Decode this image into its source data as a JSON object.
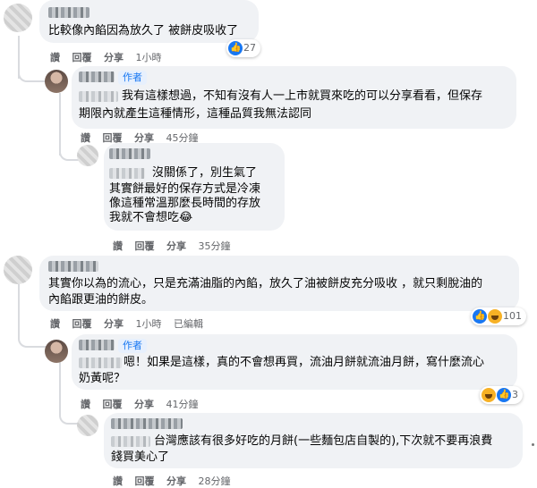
{
  "actions": {
    "like": "讚",
    "reply": "回覆",
    "share": "分享",
    "edited": "已編輯"
  },
  "author_badge": "作者",
  "comments": [
    {
      "text": "比較像內餡因為放久了 被餅皮吸收了",
      "time": "1小時",
      "reactions": "27"
    },
    {
      "line1": "我有這樣想過，不知有沒有人一上市就買來吃的可以分享看看，但保存",
      "line2": "期限內就產生這種情形，這種品質我無法認同",
      "time": "45分鐘"
    },
    {
      "line1": "沒關係了，別生氣了",
      "line2": "其實餅最好的保存方式是冷凍",
      "line3": "像這種常溫那麼長時間的存放",
      "line4": "我就不會想吃😂",
      "time": "35分鐘"
    },
    {
      "line1": "其實你以為的流心，只是充滿油脂的內餡，放久了油被餅皮充分吸收 ，就只剩脫油的",
      "line2": "內餡跟更油的餅皮。",
      "time": "1小時",
      "reactions": "101"
    },
    {
      "line1": "嗯！如果是這樣，真的不會想再買，流油月餅就流油月餅，寫什麼流心",
      "line2": "奶黃呢？",
      "time": "41分鐘",
      "reactions": "3"
    },
    {
      "line1": "台灣應該有很多好吃的月餅(一些麵包店自製的),下次就不要再浪費",
      "line2": "錢買美心了",
      "time": "28分鐘"
    }
  ],
  "icons": {
    "like": "like-icon",
    "haha": "haha-icon",
    "ellipsis": "more-options-icon"
  }
}
